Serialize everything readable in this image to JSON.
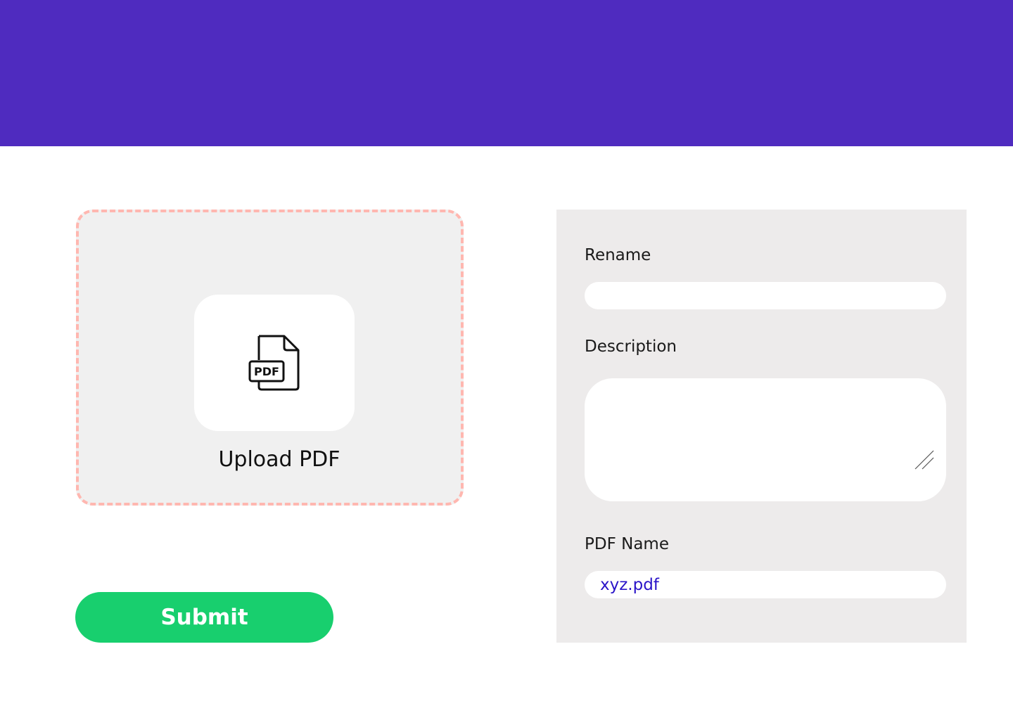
{
  "colors": {
    "header": "#4f2bbf",
    "upload_border": "#ffb7b0",
    "submit": "#18cf6e",
    "panel": "#edebeb",
    "pdf_name_text": "#2a14c8"
  },
  "upload": {
    "icon": "pdf-file-icon",
    "icon_text": "PDF",
    "label": "Upload PDF"
  },
  "submit": {
    "label": "Submit"
  },
  "form": {
    "rename": {
      "label": "Rename",
      "value": "",
      "placeholder": ""
    },
    "description": {
      "label": "Description",
      "value": ""
    },
    "pdf_name": {
      "label": "PDF Name",
      "value": "xyz.pdf"
    }
  }
}
